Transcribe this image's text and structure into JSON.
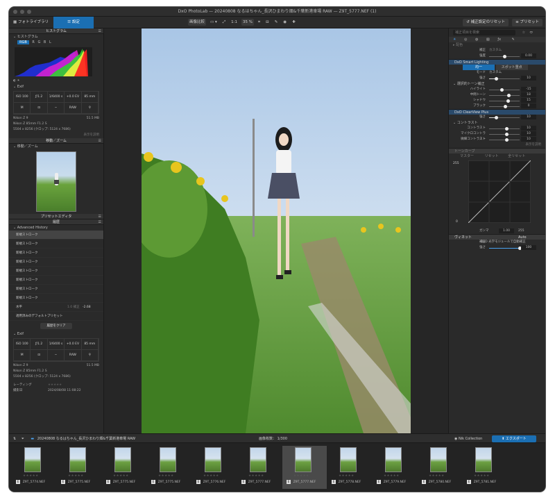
{
  "window": {
    "title": "DxO PhotoLab — 20240808 なるはちゃん_長沢ひまわり畑&千葉新港車場 RAW — Z9T_5777.NEF (1)"
  },
  "toolbar": {
    "tab_photolibrary": "フォトライブラリ",
    "tab_customize": "設定",
    "compare": "画像比較",
    "zoom_1to1": "1:1",
    "zoom_level": "35 %",
    "reset_label": "補正設定のリセット",
    "preset_label": "プリセット"
  },
  "left": {
    "histogram_header": "ヒストグラム",
    "histogram_label": "ヒストグラム",
    "channels": [
      "RGB",
      "R",
      "G",
      "B",
      "L"
    ],
    "exif_label": "Exif",
    "exif": {
      "iso": "ISO 100",
      "aperture": "ƒ/1.2",
      "shutter": "1/6400 s",
      "ev": "+0.0 EV",
      "focal": "85 mm",
      "mode": "M",
      "metering": "─",
      "format": "RAW"
    },
    "camera": "Nikon Z 9",
    "filesize": "51.5 MB",
    "lens": "Nikon Z 85mm F1.2 S",
    "dims": "5504 x 8256 (クロップ: 5124 x 7686)",
    "display_settings": "表示を説明",
    "navzoom_header": "移動／ズーム",
    "navzoom_label": "移動／ズーム",
    "preset_editor_header": "プリセットエディタ",
    "history_header": "履歴",
    "advanced_history": "Advanced History",
    "history_items": [
      "新規ストローク",
      "新規ストローク",
      "新規ストローク",
      "新規ストローク",
      "新規ストローク",
      "新規ストローク",
      "新規ストローク",
      "新規ストローク",
      "水平",
      "適用済みのデフォルトプリセット"
    ],
    "history_level_label": "1.0 補正",
    "history_level_value": "-2.68",
    "clear_history": "履歴をクリア",
    "exif2_label": "Exif",
    "rating_label": "レーティング",
    "date_label": "撮影日",
    "date_value": "2024/08/08 11:08:22"
  },
  "right": {
    "search_placeholder": "補正項目を検索",
    "section_color_label": "配色",
    "color_mode_label": "補正",
    "color_mode_value": "カスタム",
    "color_amount_label": "強度",
    "color_amount_value": "0.00",
    "smart_lighting": "DxO Smart Lighting",
    "sl_uniform": "均一",
    "sl_spot": "スポット重点",
    "sl_mode_label": "モード",
    "sl_mode_value": "カスタム",
    "sl_strength_label": "強さ",
    "sl_strength_value": "10",
    "selective_tone": "選択的トーン補正",
    "tones": [
      {
        "label": "ハイライト",
        "value": "-15",
        "pos": 0.38
      },
      {
        "label": "中間トーン",
        "value": "18",
        "pos": 0.62
      },
      {
        "label": "シャドウ",
        "value": "15",
        "pos": 0.6
      },
      {
        "label": "ブラック",
        "value": "0",
        "pos": 0.5
      }
    ],
    "clearview": "DxO ClearView Plus",
    "cv_strength_label": "強さ",
    "cv_strength_value": "10",
    "contrast": "コントラスト",
    "contrasts": [
      {
        "label": "コントラスト",
        "value": "10",
        "pos": 0.55
      },
      {
        "label": "マイクロコントラスト",
        "value": "10",
        "pos": 0.55
      },
      {
        "label": "微細コントラスト",
        "value": "10",
        "pos": 0.55
      }
    ],
    "display_settings": "表示を説明",
    "tonecurve": "トーンカーブ",
    "tc_master": "マスター",
    "tc_reset": "リセット",
    "tc_reset_all": "全リセット",
    "tc_top": "255",
    "tc_bottom": "0",
    "tc_gamma_label": "ガンマ",
    "tc_gamma": "1.00",
    "tc_right": "255",
    "vignette": "ヴィネット",
    "vig_auto": "Auto",
    "vig_mode_label": "補正",
    "vig_mode_value": "DxO 光学モジュールで自動補正",
    "vig_strength_label": "強さ",
    "vig_strength_value": "100"
  },
  "bottombar": {
    "folder": "20240808 なるはちゃん_長沢ひまわり畑&千葉新港車場 RAW",
    "count": "画像枚数： 1/300",
    "nik": "Nik Collection",
    "export": "エクスポート"
  },
  "film": [
    {
      "name": "Z9T_5774.NEF"
    },
    {
      "name": "Z9T_5775.NEF"
    },
    {
      "name": "Z9T_5775.NEF"
    },
    {
      "name": "Z9T_5775.NEF"
    },
    {
      "name": "Z9T_5776.NEF"
    },
    {
      "name": "Z9T_5777.NEF"
    },
    {
      "name": "Z9T_5777.NEF",
      "selected": true
    },
    {
      "name": "Z9T_5778.NEF"
    },
    {
      "name": "Z9T_5779.NEF"
    },
    {
      "name": "Z9T_5780.NEF"
    },
    {
      "name": "Z9T_5781.NEF"
    }
  ],
  "colors": {
    "accent": "#1b6fb3",
    "panel": "#2a2a2a"
  }
}
